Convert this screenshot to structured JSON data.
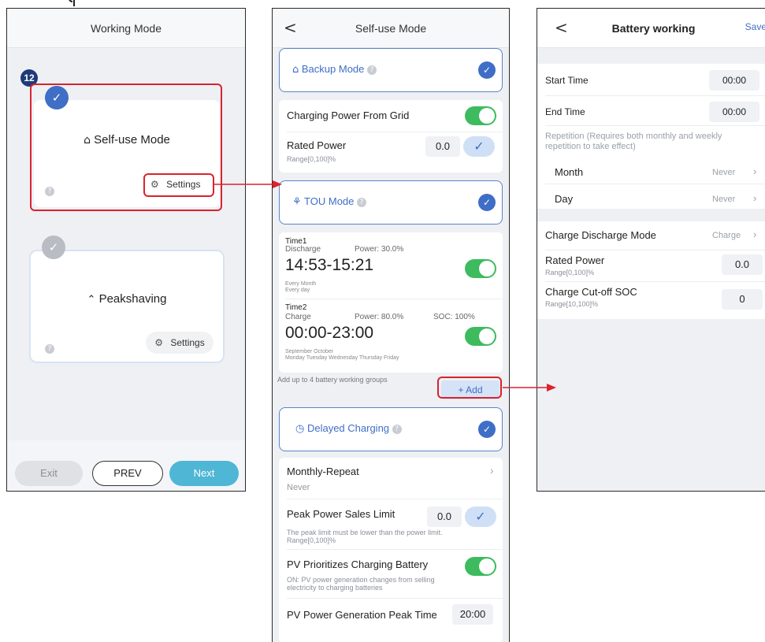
{
  "left": {
    "title": "Working Mode",
    "step_badge": "12",
    "self_use": {
      "label": "Self-use Mode",
      "settings": "Settings"
    },
    "peakshaving": {
      "label": "Peakshaving",
      "settings": "Settings"
    },
    "buttons": {
      "exit": "Exit",
      "prev": "PREV",
      "next": "Next"
    }
  },
  "middle": {
    "title": "Self-use Mode",
    "backup": {
      "label": "Backup Mode"
    },
    "charging_from_grid": "Charging Power From Grid",
    "rated_power": {
      "label": "Rated Power",
      "value": "0.0",
      "range": "Range[0,100]%"
    },
    "tou": {
      "label": "TOU Mode"
    },
    "time1": {
      "name": "Time1",
      "type": "Discharge",
      "power": "Power: 30.0%",
      "range": "14:53-15:21",
      "month": "Every Month",
      "day": "Every day"
    },
    "time2": {
      "name": "Time2",
      "type": "Charge",
      "power": "Power: 80.0%",
      "soc": "SOC: 100%",
      "range": "00:00-23:00",
      "month": "September October",
      "day": "Monday Tuesday Wednesday Thursday Friday"
    },
    "add_hint": "Add up to 4 battery working groups",
    "add_button": "+ Add",
    "delayed": {
      "label": "Delayed Charging"
    },
    "monthly_repeat": {
      "label": "Monthly-Repeat",
      "value": "Never"
    },
    "peak_sales": {
      "label": "Peak Power Sales Limit",
      "value": "0.0",
      "note1": "The peak limit must be lower than the power limit.",
      "note2": "Range[0,100]%"
    },
    "pv_prior": {
      "label": "PV Prioritizes Charging Battery",
      "note1": "ON: PV power generation changes from selling",
      "note2": "electricity to charging batteries"
    },
    "pv_peak_time": {
      "label": "PV Power Generation Peak Time",
      "value": "20:00"
    }
  },
  "right": {
    "title": "Battery working",
    "save": "Save",
    "start_time": {
      "label": "Start Time",
      "value": "00:00"
    },
    "end_time": {
      "label": "End Time",
      "value": "00:00"
    },
    "repetition": {
      "line1": "Repetition (Requires both monthly and weekly",
      "line2": "repetition to take effect)"
    },
    "month": {
      "label": "Month",
      "value": "Never"
    },
    "day": {
      "label": "Day",
      "value": "Never"
    },
    "cd_mode": {
      "label": "Charge Discharge Mode",
      "value": "Charge"
    },
    "rated_power": {
      "label": "Rated Power",
      "range": "Range[0,100]%",
      "value": "0.0"
    },
    "cutoff": {
      "label": "Charge Cut-off SOC",
      "range": "Range[10,100]%",
      "value": "0"
    }
  },
  "colors": {
    "accent": "#3f6ec6",
    "toggle": "#3dbb5e",
    "highlight": "#d9232d",
    "next": "#4fb6d6"
  }
}
